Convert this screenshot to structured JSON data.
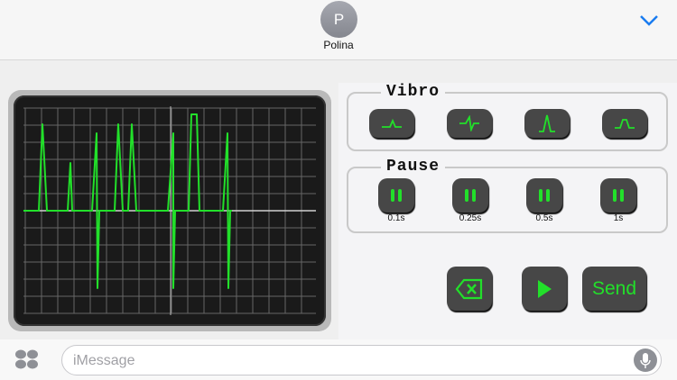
{
  "header": {
    "contact_initial": "P",
    "contact_name": "Polina"
  },
  "vibro": {
    "title": "Vibro",
    "buttons": [
      "vibro-short-icon",
      "vibro-double-icon",
      "vibro-tall-icon",
      "vibro-wide-icon"
    ]
  },
  "pause": {
    "title": "Pause",
    "buttons": [
      {
        "label": "0.1s"
      },
      {
        "label": "0.25s"
      },
      {
        "label": "0.5s"
      },
      {
        "label": "1s"
      }
    ]
  },
  "actions": {
    "send_label": "Send"
  },
  "compose": {
    "placeholder": "iMessage"
  },
  "colors": {
    "accent": "#22e02a",
    "chevron": "#1a7cf0"
  }
}
